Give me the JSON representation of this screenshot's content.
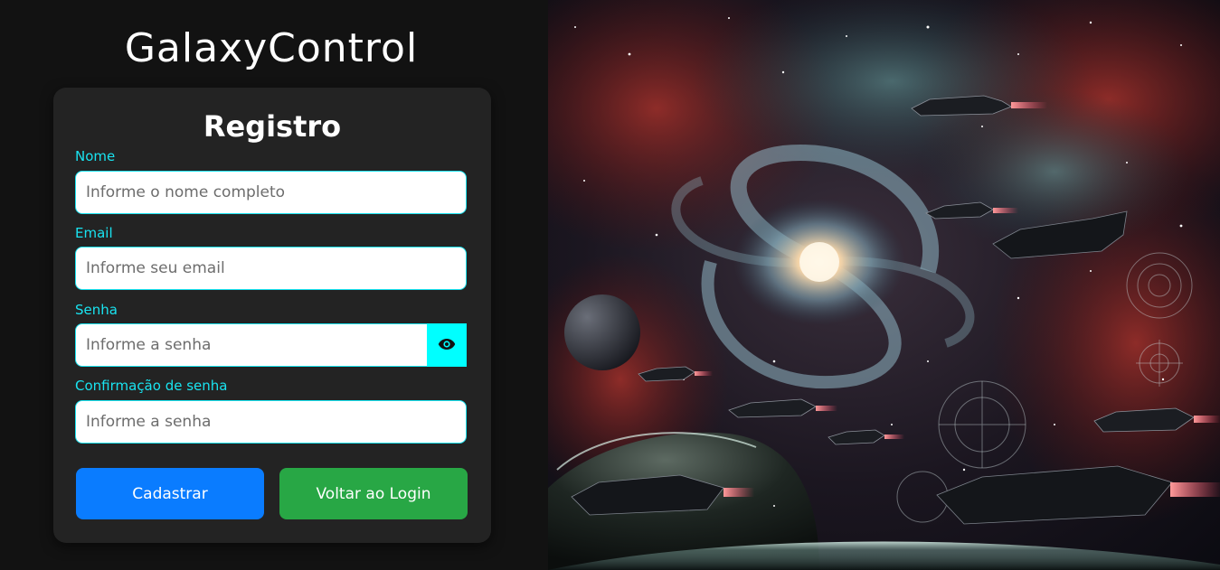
{
  "app": {
    "title": "GalaxyControl"
  },
  "form": {
    "title": "Registro",
    "name": {
      "label": "Nome",
      "placeholder": "Informe o nome completo"
    },
    "email": {
      "label": "Email",
      "placeholder": "Informe seu email"
    },
    "password": {
      "label": "Senha",
      "placeholder": "Informe a senha",
      "toggle_icon": "eye-icon"
    },
    "confirm": {
      "label": "Confirmação de senha",
      "placeholder": "Informe a senha"
    },
    "submit_label": "Cadastrar",
    "back_label": "Voltar ao Login"
  },
  "colors": {
    "accent": "#19e3f0",
    "primary": "#0a7cff",
    "success": "#28a745",
    "eye_button": "#00ffff",
    "card": "#232323",
    "background": "#121212"
  },
  "hero": {
    "description_icon": "galaxy-spaceships-illustration"
  }
}
